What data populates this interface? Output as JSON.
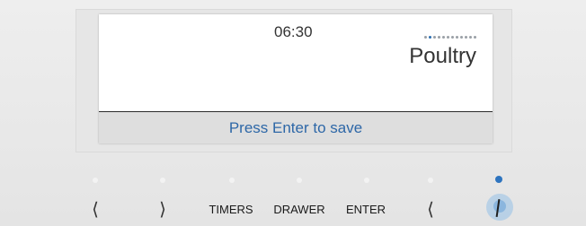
{
  "display": {
    "time": "06:30",
    "mode_name": "Poultry",
    "status_message": "Press Enter to save",
    "mode_indicator": {
      "count": 12,
      "active_index": 1
    }
  },
  "buttons": {
    "left_arrow": "⟨",
    "right_arrow": "⟩",
    "timers": "TIMERS",
    "drawer": "DRAWER",
    "enter": "ENTER",
    "back_arrow": "⟨"
  },
  "colors": {
    "accent": "#2e74bf",
    "status_text": "#2d67a7"
  }
}
